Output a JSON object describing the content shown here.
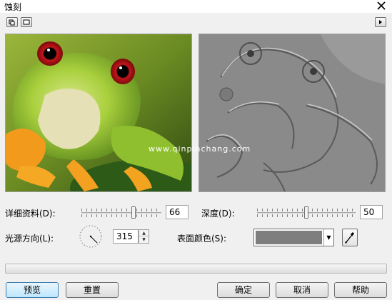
{
  "window": {
    "title": "蚀刻"
  },
  "preview_toolbar": {
    "left_buttons": [
      "two-panel-view-icon",
      "single-panel-view-icon"
    ],
    "right_button": "play-arrow-icon"
  },
  "watermark": "www.qinpinchang.com",
  "controls": {
    "detail": {
      "label": "详细资料(D):",
      "value": "66",
      "level": 66
    },
    "depth": {
      "label": "深度(D):",
      "value": "50",
      "level": 50
    },
    "light_direction": {
      "label": "光源方向(L):",
      "value": "315",
      "angle": 315
    },
    "surface_color": {
      "label": "表面颜色(S):",
      "color": "#7e7e7e"
    }
  },
  "progress": {
    "value": 0
  },
  "buttons": {
    "preview": "预览",
    "reset": "重置",
    "ok": "确定",
    "cancel": "取消",
    "help": "帮助"
  }
}
